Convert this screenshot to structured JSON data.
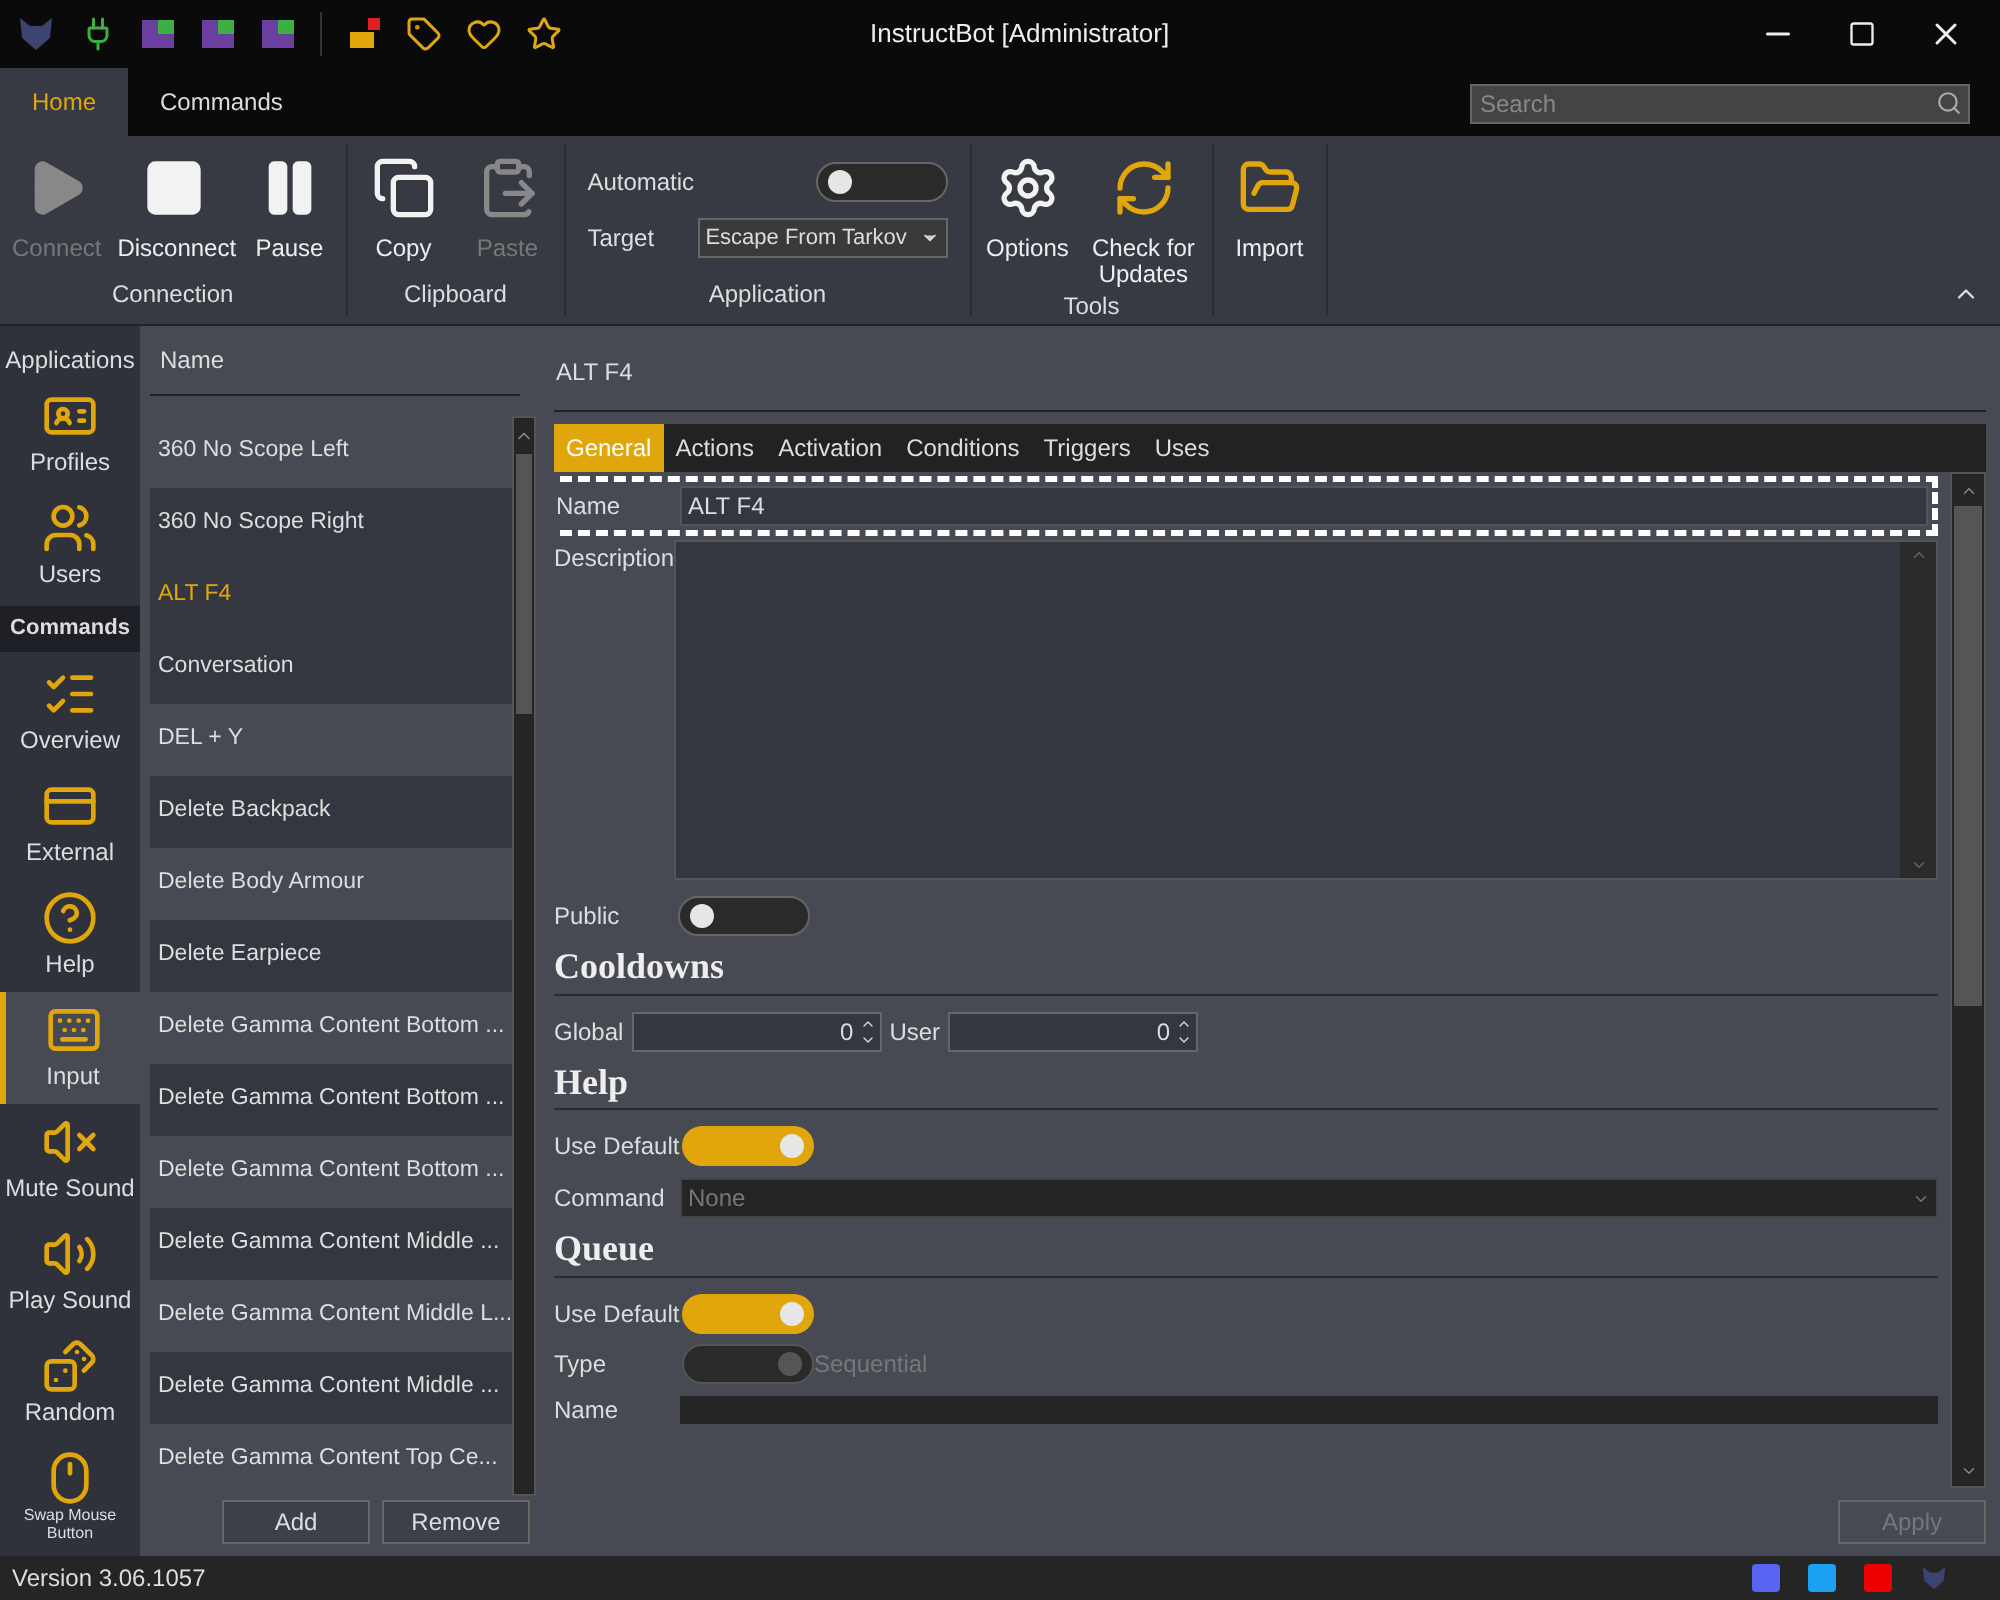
{
  "window": {
    "title": "InstructBot [Administrator]"
  },
  "ribbon_tabs": [
    {
      "label": "Home",
      "selected": true
    },
    {
      "label": "Commands",
      "selected": false
    }
  ],
  "search": {
    "placeholder": "Search"
  },
  "ribbon_groups": [
    {
      "label": "Connection",
      "items": [
        {
          "kind": "button",
          "label": "Connect",
          "disabled": true
        },
        {
          "kind": "button",
          "label": "Disconnect",
          "disabled": false
        },
        {
          "kind": "button",
          "label": "Pause",
          "disabled": false
        }
      ]
    },
    {
      "label": "Clipboard",
      "items": [
        {
          "kind": "button",
          "label": "Copy",
          "disabled": false
        },
        {
          "kind": "button",
          "label": "Paste",
          "disabled": true
        }
      ]
    },
    {
      "label": "Application",
      "items": [
        {
          "kind": "toggle",
          "label": "Automatic",
          "on": false
        },
        {
          "kind": "dropdown",
          "label": "Target",
          "value": "Escape From Tarkov"
        }
      ]
    },
    {
      "label": "Tools",
      "items": [
        {
          "kind": "button",
          "label": "Options",
          "disabled": false
        },
        {
          "kind": "button",
          "label": "Check for Updates",
          "disabled": false
        }
      ]
    },
    {
      "items": [
        {
          "kind": "button",
          "label": "Import",
          "disabled": false
        }
      ]
    }
  ],
  "sidebar": [
    {
      "kind": "item",
      "label": "Applications",
      "selected": false
    },
    {
      "kind": "item",
      "label": "Profiles",
      "selected": false
    },
    {
      "kind": "item",
      "label": "Users",
      "selected": false
    },
    {
      "kind": "header",
      "label": "Commands"
    },
    {
      "kind": "item",
      "label": "Overview",
      "selected": false
    },
    {
      "kind": "item",
      "label": "External",
      "selected": false
    },
    {
      "kind": "item",
      "label": "Help",
      "selected": false
    },
    {
      "kind": "item",
      "label": "Input",
      "selected": true
    },
    {
      "kind": "item",
      "label": "Mute Sound",
      "selected": false
    },
    {
      "kind": "item",
      "label": "Play Sound",
      "selected": false
    },
    {
      "kind": "item",
      "label": "Random",
      "selected": false
    },
    {
      "kind": "small",
      "label": "Swap Mouse Button",
      "selected": false
    }
  ],
  "list": {
    "column": "Name",
    "rows": [
      {
        "label": "360 No Scope Left",
        "selected": false
      },
      {
        "label": "360 No Scope Right",
        "selected": false
      },
      {
        "label": "ALT F4",
        "selected": true
      },
      {
        "label": "Conversation",
        "selected": false
      },
      {
        "label": "DEL  + Y",
        "selected": false
      },
      {
        "label": "Delete Backpack",
        "selected": false
      },
      {
        "label": "Delete Body Armour",
        "selected": false
      },
      {
        "label": "Delete Earpiece",
        "selected": false
      },
      {
        "label": "Delete Gamma Content Bottom ...",
        "selected": false
      },
      {
        "label": "Delete Gamma Content Bottom ...",
        "selected": false
      },
      {
        "label": "Delete Gamma Content Bottom ...",
        "selected": false
      },
      {
        "label": "Delete Gamma Content Middle ...",
        "selected": false
      },
      {
        "label": "Delete Gamma Content Middle L...",
        "selected": false
      },
      {
        "label": "Delete Gamma Content Middle ...",
        "selected": false
      },
      {
        "label": "Delete Gamma Content Top Ce...",
        "selected": false
      }
    ],
    "buttons": [
      "Add",
      "Remove"
    ]
  },
  "detail": {
    "title": "ALT F4",
    "tabs": [
      {
        "label": "General",
        "selected": true
      },
      {
        "label": "Actions",
        "selected": false
      },
      {
        "label": "Activation",
        "selected": false
      },
      {
        "label": "Conditions",
        "selected": false
      },
      {
        "label": "Triggers",
        "selected": false
      },
      {
        "label": "Uses",
        "selected": false
      }
    ],
    "name": {
      "label": "Name",
      "value": "ALT F4"
    },
    "description": {
      "label": "Description"
    },
    "public": {
      "label": "Public",
      "on": false
    },
    "cooldowns": {
      "heading": "Cooldowns",
      "fields": [
        {
          "label": "Global",
          "value": "0"
        },
        {
          "label": "User",
          "value": "0"
        }
      ]
    },
    "help": {
      "heading": "Help",
      "use_default": {
        "label": "Use Default",
        "on": true
      },
      "command": {
        "label": "Command",
        "value": "None"
      }
    },
    "queue": {
      "heading": "Queue",
      "use_default": {
        "label": "Use Default",
        "on": true
      },
      "type": {
        "label": "Type",
        "on": true,
        "disabled": true,
        "caption": "Sequential"
      },
      "name": {
        "label": "Name"
      }
    },
    "apply": {
      "label": "Apply",
      "disabled": true
    }
  },
  "status_bar": {
    "version": "Version 3.06.1057"
  }
}
